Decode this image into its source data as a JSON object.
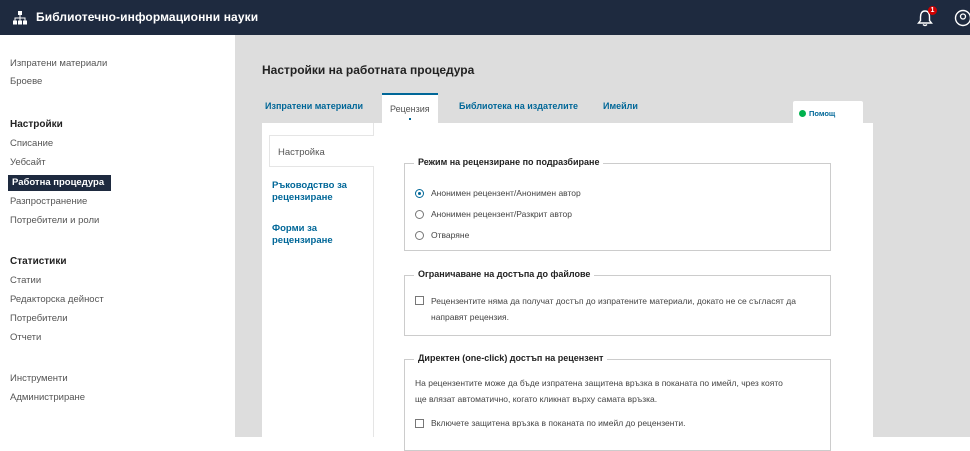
{
  "header": {
    "site_name": "Библиотечно-информационни науки",
    "notification_count": "1",
    "colors": {
      "bar": "#1e2a3f",
      "accent": "#006798",
      "badge": "#d00000"
    },
    "icons": [
      "sitemap-icon",
      "bell-icon",
      "user-icon"
    ]
  },
  "sidebar": {
    "top_links": [
      "Изпратени материали",
      "Броеве"
    ],
    "settings_heading": "Настройки",
    "settings_items": [
      "Списание",
      "Уебсайт",
      "Работна процедура",
      "Разпространение",
      "Потребители и роли"
    ],
    "active_item": "Работна процедура",
    "stats_heading": "Статистики",
    "stats_items": [
      "Статии",
      "Редакторска дейност",
      "Потребители",
      "Отчети"
    ],
    "bottom_links": [
      "Инструменти",
      "Администриране"
    ]
  },
  "main": {
    "title": "Настройки на работната процедура",
    "tabs": [
      "Изпратени материали",
      "Рецензия",
      "Библиотека на издателите",
      "Имейли"
    ],
    "active_tab": "Рецензия",
    "help_label": "Помощ"
  },
  "subnav": {
    "items": [
      "Настройка",
      "Ръководство за рецензиране",
      "Форми за рецензиране"
    ]
  },
  "review_mode": {
    "legend": "Режим на рецензиране по подразбиране",
    "options": [
      "Анонимен рецензент/Анонимен автор",
      "Анонимен рецензент/Разкрит автор",
      "Отваряне"
    ],
    "selected_index": 0
  },
  "file_access": {
    "legend": "Ограничаване на достъпа до файлове",
    "checkbox_label_line1": "Рецензентите няма да получат достъп до изпратените материали, докато не се съгласят да",
    "checkbox_label_line2": "направят рецензия.",
    "checked": false
  },
  "one_click": {
    "legend": "Директен (one-click) достъп на рецензент",
    "description_line1": "На рецензентите може да бъде изпратена защитена връзка в поканата по имейл, чрез която",
    "description_line2": "ще влязат автоматично, когато кликнат върху самата връзка.",
    "checkbox_label": "Включете защитена връзка в поканата по имейл до рецензенти.",
    "checked": false
  }
}
